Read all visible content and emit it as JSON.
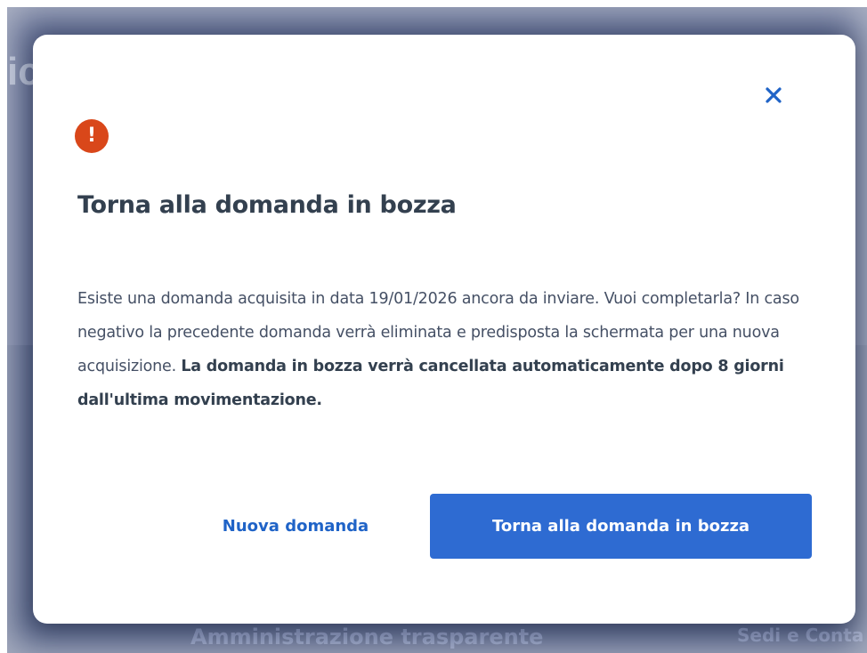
{
  "background": {
    "heading_fragment": "ic",
    "footer_link_left": "Amministrazione trasparente",
    "footer_link_right": "Sedi e Conta"
  },
  "modal": {
    "close_icon": "close-icon",
    "alert_icon": "exclamation-icon",
    "alert_glyph": "!",
    "title": "Torna alla domanda in bozza",
    "body_regular": "Esiste una domanda acquisita in data 19/01/2026 ancora da inviare. Vuoi completarla? In caso negativo la precedente domanda verrà eliminata e predisposta la schermata per una nuova acquisizione. ",
    "body_bold": "La domanda in bozza verrà cancellata automaticamente dopo 8 giorni dall'ultima movimentazione.",
    "secondary_button_label": "Nuova domanda",
    "primary_button_label": "Torna alla domanda in bozza"
  },
  "colors": {
    "accent": "#2e6bd2",
    "link": "#1f63c7",
    "alert": "#d9471a",
    "title": "#33404f",
    "body": "#455065",
    "backdrop": "#425078"
  }
}
